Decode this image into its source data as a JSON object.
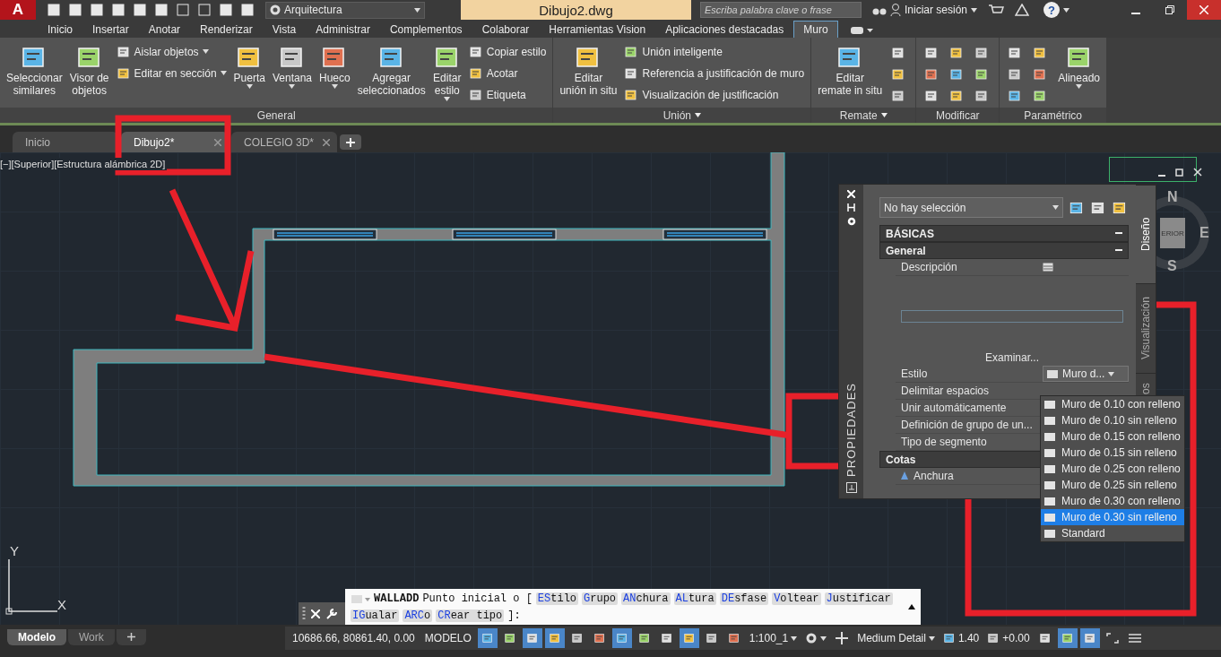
{
  "app_button": {
    "label": "A"
  },
  "workspace": {
    "value": "Arquitectura"
  },
  "title": "Dibujo2.dwg",
  "search": {
    "placeholder": "Escriba palabra clave o frase"
  },
  "sign_in": "Iniciar sesión",
  "help": "?",
  "ribbon_tabs": [
    {
      "label": "Inicio",
      "selected": false
    },
    {
      "label": "Insertar",
      "selected": false
    },
    {
      "label": "Anotar",
      "selected": false
    },
    {
      "label": "Renderizar",
      "selected": false
    },
    {
      "label": "Vista",
      "selected": false
    },
    {
      "label": "Administrar",
      "selected": false
    },
    {
      "label": "Complementos",
      "selected": false
    },
    {
      "label": "Colaborar",
      "selected": false
    },
    {
      "label": "Herramientas Vision",
      "selected": false
    },
    {
      "label": "Aplicaciones destacadas",
      "selected": false
    },
    {
      "label": "Muro",
      "selected": true
    }
  ],
  "ribbon_panels": [
    {
      "title": "General",
      "has_menu": false,
      "items": [
        {
          "kind": "large",
          "label": "Seleccionar\nsimilares",
          "menu": false
        },
        {
          "kind": "large",
          "label": "Visor de\nobjetos",
          "menu": false
        },
        {
          "kind": "stack",
          "entries": [
            {
              "label": "Aislar objetos",
              "menu": true
            },
            {
              "label": "Editar en sección",
              "menu": true
            }
          ]
        },
        {
          "kind": "large",
          "label": "Puerta",
          "menu": true
        },
        {
          "kind": "large",
          "label": "Ventana",
          "menu": true
        },
        {
          "kind": "large",
          "label": "Hueco",
          "menu": true
        },
        {
          "kind": "large",
          "label": "Agregar\nseleccionados",
          "menu": false
        },
        {
          "kind": "large",
          "label": "Editar\nestilo",
          "menu": true
        },
        {
          "kind": "stack",
          "entries": [
            {
              "label": "Copiar estilo",
              "menu": false
            },
            {
              "label": "Acotar",
              "menu": false
            },
            {
              "label": "Etiqueta",
              "menu": false
            }
          ]
        }
      ]
    },
    {
      "title": "Unión",
      "has_menu": true,
      "items": [
        {
          "kind": "large",
          "label": "Editar\nunión in situ",
          "menu": false
        },
        {
          "kind": "stack",
          "entries": [
            {
              "label": "Unión inteligente",
              "menu": false
            },
            {
              "label": "Referencia a justificación de muro",
              "menu": false
            },
            {
              "label": "Visualización de justificación",
              "menu": false
            }
          ]
        }
      ]
    },
    {
      "title": "Remate",
      "has_menu": true,
      "items": [
        {
          "kind": "large",
          "label": "Editar\nremate in situ",
          "menu": false
        },
        {
          "kind": "icon_column"
        }
      ]
    },
    {
      "title": "Modificar",
      "has_menu": false,
      "items": [
        {
          "kind": "icon_grid"
        }
      ]
    },
    {
      "title": "Paramétrico",
      "has_menu": false,
      "items": [
        {
          "kind": "icon_pairs"
        },
        {
          "kind": "large",
          "label": "Alineado",
          "menu": true
        }
      ]
    }
  ],
  "doc_tabs": [
    {
      "label": "Inicio",
      "selected": false,
      "closable": false
    },
    {
      "label": "Dibujo2*",
      "selected": true,
      "closable": true
    },
    {
      "label": "COLEGIO 3D*",
      "selected": false,
      "closable": true
    }
  ],
  "viewport_label": "[−][Superior][Estructura alámbrica 2D]",
  "viewcube": {
    "face": "ERIOR",
    "north": "N",
    "east": "E",
    "south": "S"
  },
  "properties": {
    "title": "PROPIEDADES",
    "selection": "No hay selección",
    "side_tabs": [
      {
        "label": "Diseño",
        "selected": true
      },
      {
        "label": "Visualización",
        "selected": false
      },
      {
        "label": "os",
        "selected": false
      }
    ],
    "category": "BÁSICAS",
    "groups": [
      {
        "title": "General",
        "rows": [
          {
            "kind": "icon_value",
            "label": "Descripción"
          },
          {
            "kind": "browse",
            "action": "Examinar..."
          },
          {
            "kind": "dropdown",
            "label": "Estilo",
            "value": "Muro d..."
          },
          {
            "kind": "plain",
            "label": "Delimitar espacios"
          },
          {
            "kind": "plain",
            "label": "Unir automáticamente"
          },
          {
            "kind": "plain",
            "label": "Definición de grupo de un..."
          },
          {
            "kind": "plain",
            "label": "Tipo de segmento"
          }
        ]
      },
      {
        "title": "Cotas",
        "rows": [
          {
            "kind": "dimension",
            "label": "Anchura"
          }
        ]
      }
    ]
  },
  "style_menu": [
    {
      "label": "Muro de 0.10 con relleno",
      "selected": false
    },
    {
      "label": "Muro de 0.10 sin relleno",
      "selected": false
    },
    {
      "label": "Muro de 0.15 con relleno",
      "selected": false
    },
    {
      "label": "Muro de 0.15 sin relleno",
      "selected": false
    },
    {
      "label": "Muro de 0.25 con relleno",
      "selected": false
    },
    {
      "label": "Muro de 0.25 sin relleno",
      "selected": false
    },
    {
      "label": "Muro de 0.30 con relleno",
      "selected": false
    },
    {
      "label": "Muro de 0.30 sin relleno",
      "selected": true
    },
    {
      "label": "Standard",
      "selected": false
    }
  ],
  "ucs": {
    "y": "Y",
    "x": "X"
  },
  "command": {
    "name": "WALLADD",
    "prompt": "Punto inicial o [",
    "options": [
      {
        "key": "ES",
        "rest": "tilo"
      },
      {
        "key": "G",
        "rest": "rupo"
      },
      {
        "key": "AN",
        "rest": "chura"
      },
      {
        "key": "AL",
        "rest": "tura"
      },
      {
        "key": "DE",
        "rest": "sfase"
      },
      {
        "key": "V",
        "rest": "oltear"
      },
      {
        "key": "J",
        "rest": "ustificar"
      },
      {
        "key": "IG",
        "rest": "ualar"
      },
      {
        "key": "ARC",
        "rest": "o"
      },
      {
        "key": "CR",
        "rest": "ear tipo"
      }
    ],
    "end": "]:"
  },
  "layout_tabs": [
    {
      "label": "Modelo",
      "selected": true
    },
    {
      "label": "Work",
      "selected": false
    }
  ],
  "status_bar": {
    "coordinates": "10686.66, 80861.40, 0.00",
    "space": "MODELO",
    "toggles": [
      {
        "on": true
      },
      {
        "on": false
      },
      {
        "on": true
      },
      {
        "on": true
      },
      {
        "on": false
      },
      {
        "on": false
      },
      {
        "on": true
      },
      {
        "on": false
      },
      {
        "on": false
      },
      {
        "on": true
      },
      {
        "on": false
      },
      {
        "on": false
      }
    ],
    "scale": "1:100_1",
    "detail": "Medium Detail",
    "lineweight": "1.40",
    "elevation": "+0.00",
    "right_toggles": [
      {
        "on": true
      },
      {
        "on": true
      }
    ]
  }
}
